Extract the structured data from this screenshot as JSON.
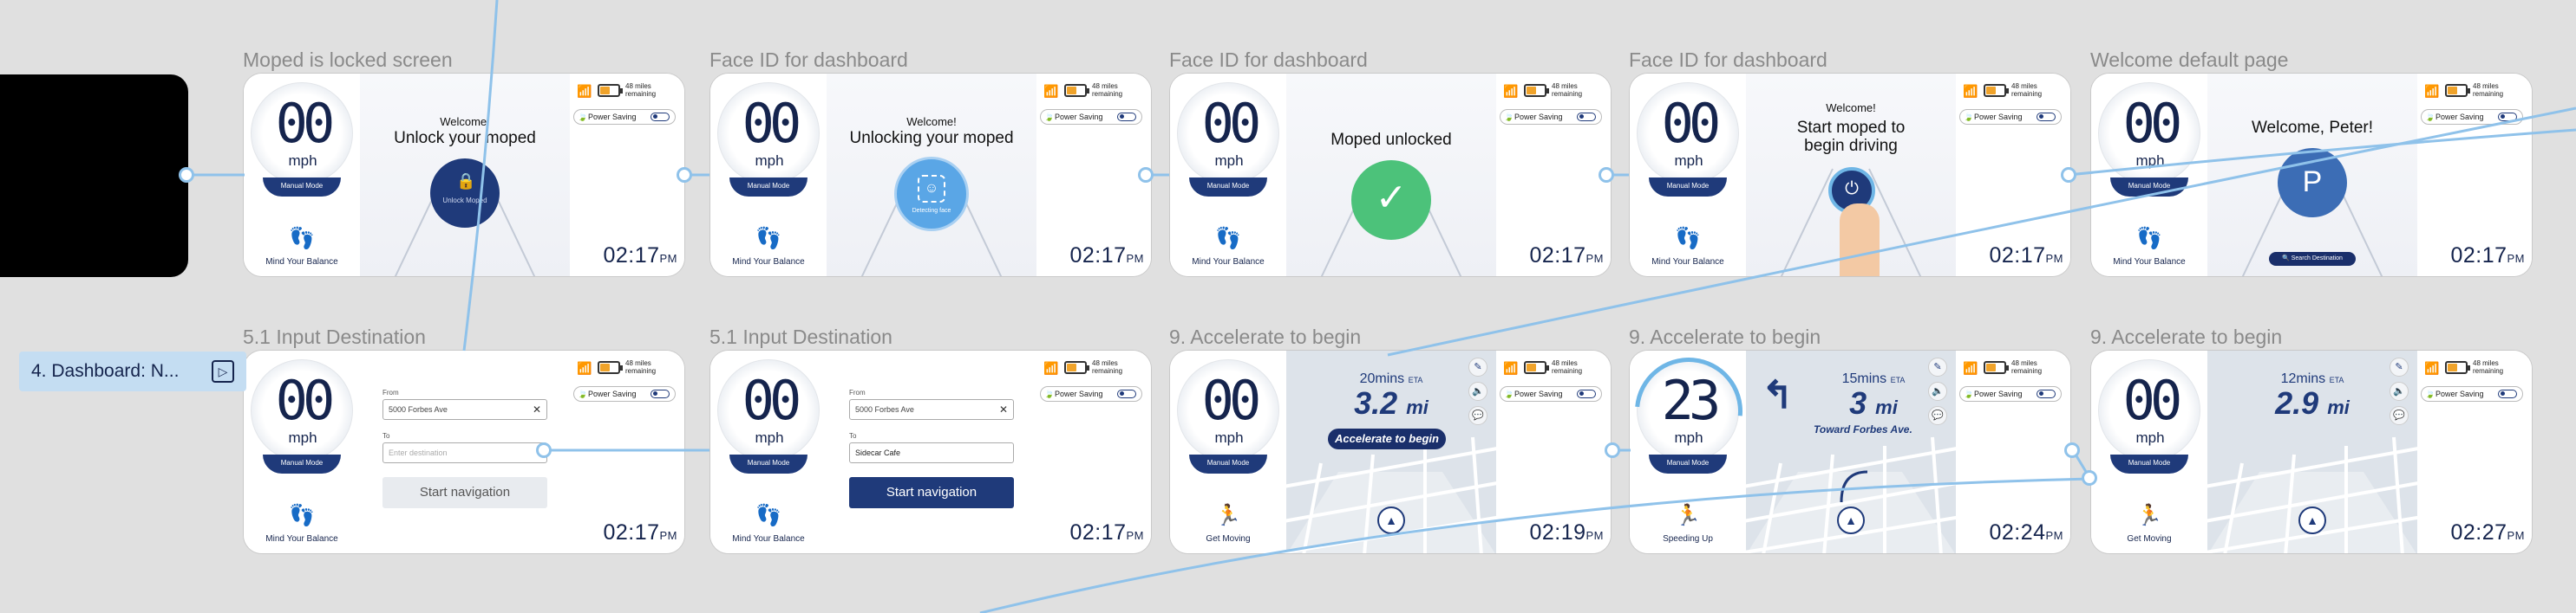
{
  "frames": {
    "f1": {
      "title": "Moped is locked screen"
    },
    "f2": {
      "title": "Face ID for dashboard"
    },
    "f3": {
      "title": "Face ID for dashboard"
    },
    "f4": {
      "title": "Face ID for dashboard"
    },
    "f5": {
      "title": "Welcome default page"
    },
    "f6": {
      "title": "5.1 Input Destination"
    },
    "f7": {
      "title": "5.1 Input Destination"
    },
    "f8": {
      "title": "9. Accelerate to begin"
    },
    "f9": {
      "title": "9. Accelerate to begin"
    },
    "f10": {
      "title": "9. Accelerate to begin"
    }
  },
  "sidebar": {
    "pill_label": "4. Dashboard: N..."
  },
  "common": {
    "unit": "mph",
    "mode": "Manual Mode",
    "miles": "48 miles remaining",
    "power_saving": "Power Saving",
    "time_suffix": "PM",
    "balance": "Mind Your Balance"
  },
  "screens": {
    "s1": {
      "speed": "00",
      "welcome": "Welcome!",
      "headline": "Unlock your moped",
      "button": "Unlock Moped",
      "time": "02:17"
    },
    "s2": {
      "speed": "00",
      "welcome": "Welcome!",
      "headline": "Unlocking your moped",
      "button": "Detecting face",
      "time": "02:17"
    },
    "s3": {
      "speed": "00",
      "headline": "Moped unlocked",
      "time": "02:17"
    },
    "s4": {
      "speed": "00",
      "welcome": "Welcome!",
      "headline": "Start moped to begin driving",
      "time": "02:17"
    },
    "s5": {
      "speed": "00",
      "headline": "Welcome, Peter!",
      "avatar": "P",
      "button": "Search Destination",
      "time": "02:17"
    },
    "s6": {
      "speed": "00",
      "from_label": "From",
      "from_value": "5000 Forbes Ave",
      "to_label": "To",
      "to_placeholder": "Enter destination",
      "nav": "Start navigation",
      "time": "02:17"
    },
    "s7": {
      "speed": "00",
      "from_label": "From",
      "from_value": "5000 Forbes Ave",
      "to_label": "To",
      "to_value": "Sidecar Cafe",
      "nav": "Start navigation",
      "time": "02:17"
    },
    "s8": {
      "speed": "00",
      "eta_value": "20mins",
      "eta_label": "ETA",
      "dist_value": "3.2",
      "dist_unit": "mi",
      "accel": "Accelerate to begin",
      "status": "Get Moving",
      "time": "02:19"
    },
    "s9": {
      "speed": "23",
      "eta_value": "15mins",
      "eta_label": "ETA",
      "dist_value": "3",
      "dist_unit": "mi",
      "toward": "Toward Forbes Ave.",
      "status": "Speeding Up",
      "time": "02:24"
    },
    "s10": {
      "speed": "00",
      "eta_value": "12mins",
      "eta_label": "ETA",
      "dist_value": "2.9",
      "dist_unit": "mi",
      "status": "Get Moving",
      "time": "02:27"
    }
  },
  "colors": {
    "navy": "#1f3a7a",
    "accent": "#6fb6e6",
    "green": "#4cc27a",
    "battery": "#f0a32a"
  }
}
